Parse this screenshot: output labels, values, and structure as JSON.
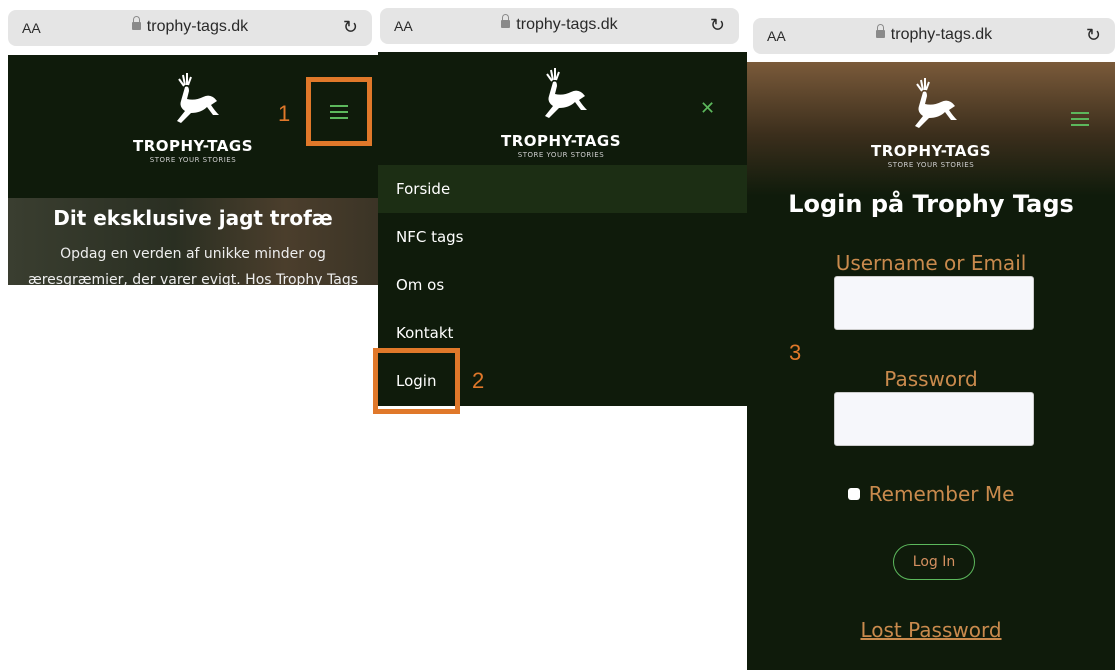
{
  "browser": {
    "text_size_label": "AA",
    "url": "trophy-tags.dk"
  },
  "brand": {
    "name": "TROPHY-TAGS",
    "tagline": "STORE YOUR STORIES"
  },
  "panel1": {
    "step": "1",
    "hero_title": "Dit eksklusive jagt trofæ",
    "hero_line1": "Opdag en verden af unikke minder og",
    "hero_line2": "æresgræmier, der varer evigt. Hos Trophy Tags"
  },
  "panel2": {
    "step": "2",
    "menu": [
      {
        "label": "Forside"
      },
      {
        "label": "NFC tags"
      },
      {
        "label": "Om os"
      },
      {
        "label": "Kontakt"
      },
      {
        "label": "Login"
      }
    ]
  },
  "panel3": {
    "step": "3",
    "title": "Login på Trophy Tags",
    "username_label": "Username or Email",
    "password_label": "Password",
    "remember_label": "Remember Me",
    "login_button": "Log In",
    "lost_password": "Lost Password"
  },
  "colors": {
    "background_dark": "#0f1b0b",
    "accent_green": "#5cb85c",
    "highlight_orange": "#e0782a",
    "label_brown": "#c98a4d"
  }
}
